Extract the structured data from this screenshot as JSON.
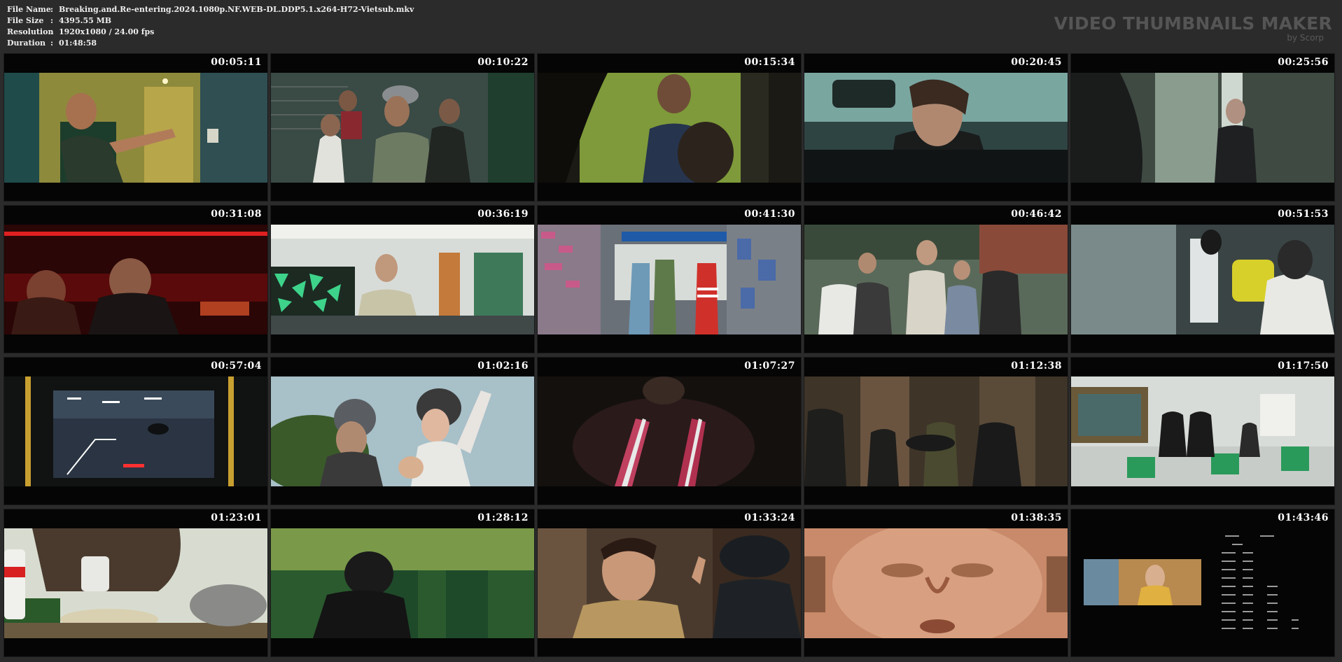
{
  "header": {
    "file_name": {
      "label": "File Name",
      "sep": ":",
      "value": "Breaking.and.Re-entering.2024.1080p.NF.WEB-DL.DDP5.1.x264-H72-Vietsub.mkv"
    },
    "file_size": {
      "label": "File Size",
      "sep": ":",
      "value": "4395.55 MB"
    },
    "resolution": {
      "label": "Resolution",
      "sep": ":",
      "value": "1920x1080 / 24.00 fps"
    },
    "duration": {
      "label": "Duration",
      "sep": ":",
      "value": "01:48:58"
    }
  },
  "brand": {
    "title": "VIDEO THUMBNAILS MAKER",
    "subtitle": "by Scorp"
  },
  "colors": {
    "background": "#2b2b2b",
    "cell": "#050505",
    "timestamp": "#ffffff",
    "brand": "#555555"
  },
  "thumbnails": [
    {
      "time": "00:05:11"
    },
    {
      "time": "00:10:22"
    },
    {
      "time": "00:15:34"
    },
    {
      "time": "00:20:45"
    },
    {
      "time": "00:25:56"
    },
    {
      "time": "00:31:08"
    },
    {
      "time": "00:36:19"
    },
    {
      "time": "00:41:30"
    },
    {
      "time": "00:46:42"
    },
    {
      "time": "00:51:53"
    },
    {
      "time": "00:57:04"
    },
    {
      "time": "01:02:16"
    },
    {
      "time": "01:07:27"
    },
    {
      "time": "01:12:38"
    },
    {
      "time": "01:17:50"
    },
    {
      "time": "01:23:01"
    },
    {
      "time": "01:28:12"
    },
    {
      "time": "01:33:24"
    },
    {
      "time": "01:38:35"
    },
    {
      "time": "01:43:46"
    }
  ]
}
